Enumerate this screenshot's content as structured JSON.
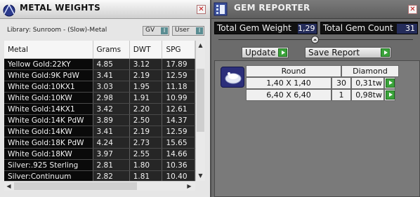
{
  "left_panel": {
    "title": "METAL WEIGHTS",
    "close_glyph": "✕",
    "library_label": "Library: Sunroom - (Slow)-Metal",
    "toggle_gv": "GV",
    "toggle_user": "User",
    "toggle_glyph": "I",
    "columns": [
      "Metal",
      "Grams",
      "DWT",
      "SPG"
    ],
    "rows": [
      [
        "Yellow Gold:22KY",
        "4.85",
        "3.12",
        "17.89"
      ],
      [
        "White Gold:9K PdW",
        "3.41",
        "2.19",
        "12.59"
      ],
      [
        "White Gold:10KX1",
        "3.03",
        "1.95",
        "11.18"
      ],
      [
        "White Gold:10KW",
        "2.98",
        "1.91",
        "10.99"
      ],
      [
        "White Gold:14KX1",
        "3.42",
        "2.20",
        "12.61"
      ],
      [
        "White Gold:14K PdW",
        "3.89",
        "2.50",
        "14.37"
      ],
      [
        "White Gold:14KW",
        "3.41",
        "2.19",
        "12.59"
      ],
      [
        "White Gold:18K PdW",
        "4.24",
        "2.73",
        "15.65"
      ],
      [
        "White Gold:18KW",
        "3.97",
        "2.55",
        "14.66"
      ],
      [
        "Silver:.925 Sterling",
        "2.81",
        "1.80",
        "10.36"
      ],
      [
        "Silver:Continuum",
        "2.82",
        "1.81",
        "10.40"
      ]
    ],
    "scroll_up": "▲",
    "scroll_down": "▼",
    "scroll_left": "◀",
    "scroll_right": "▶"
  },
  "right_panel": {
    "title": "GEM REPORTER",
    "close_glyph": "✕",
    "total_gem_weight_label": "Total Gem Weight",
    "total_gem_weight": "1,29",
    "total_gem_count_label": "Total Gem Count",
    "total_gem_count": "31",
    "collapse_glyph": "⏶",
    "update_label": "Update",
    "save_report_label": "Save Report",
    "gem_group": {
      "shape": "Round",
      "type": "Diamond",
      "rows": [
        {
          "size": "1,40 X 1,40",
          "qty": "30",
          "weight": "0,31tw"
        },
        {
          "size": "6,40 X 6,40",
          "qty": "1",
          "weight": "0,98tw"
        }
      ]
    }
  },
  "colors": {
    "grid_bg": "#0a0a0a",
    "stat_value_bg": "#242c5a",
    "go_button": "#3aa33a",
    "panel_bg_right": "#6b6b6b"
  },
  "icons": {
    "metal_weights": "metal-weights-icon",
    "gem_reporter": "gem-reporter-icon",
    "gem_thumbnail": "gem-thumbnail-icon"
  }
}
